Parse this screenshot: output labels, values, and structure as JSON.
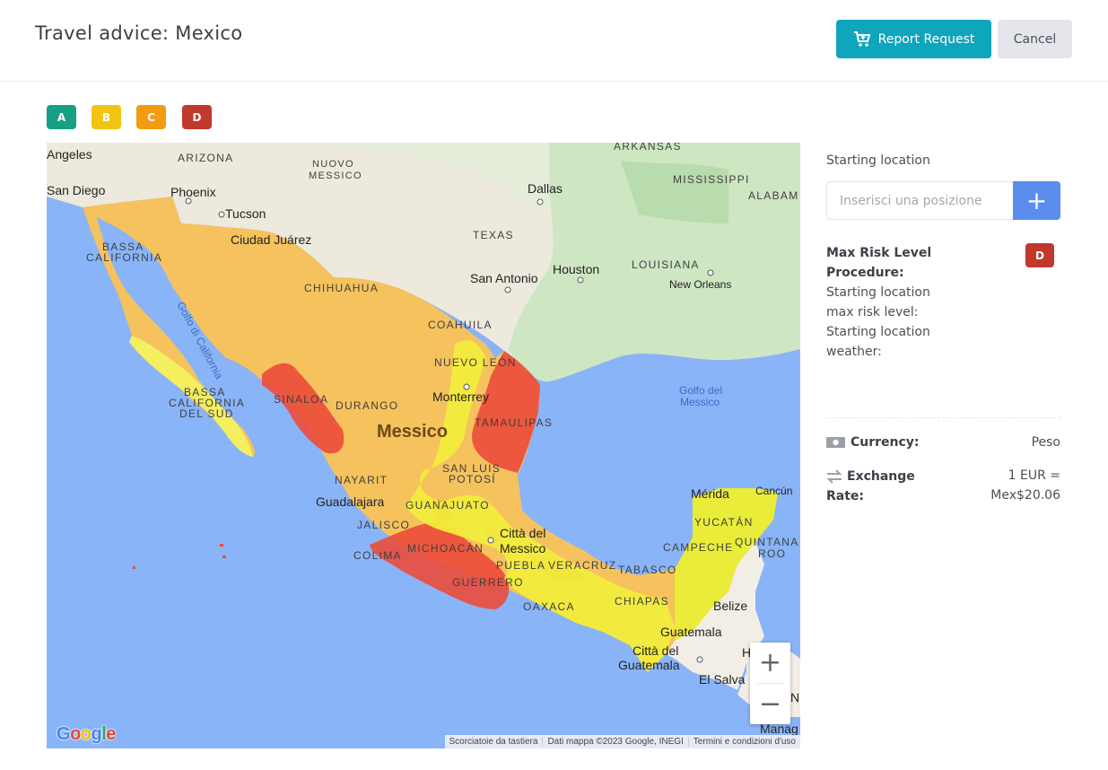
{
  "header": {
    "title": "Travel advice: Mexico",
    "report_label": "Report Request",
    "cancel_label": "Cancel"
  },
  "legend": [
    {
      "label": "A",
      "color": "#16a085"
    },
    {
      "label": "B",
      "color": "#f1c40f"
    },
    {
      "label": "C",
      "color": "#f39c12"
    },
    {
      "label": "D",
      "color": "#c0392b"
    }
  ],
  "map": {
    "labels": {
      "angeles": "Angeles",
      "arizona": "ARIZONA",
      "nuovo_messico": "NUOVO",
      "nuovo_messico2": "MESSICO",
      "arkansas": "ARKANSAS",
      "mississippi": "MISSISSIPPI",
      "alabama": "ALABAM",
      "san_diego": "San Diego",
      "phoenix": "Phoenix",
      "dallas": "Dallas",
      "tucson": "Tucson",
      "ciudad_juarez": "Ciudad Juárez",
      "texas": "TEXAS",
      "bassa_california": "BASSA",
      "bassa_california2": "CALIFORNIA",
      "houston": "Houston",
      "louisiana": "LOUISIANA",
      "san_antonio": "San Antonio",
      "new_orleans": "New Orleans",
      "chihuahua": "CHIHUAHUA",
      "golfo_california": "Golfo di California",
      "coahuila": "COAHUILA",
      "nuevo_leon": "NUEVO LEÓN",
      "bcs1": "BASSA",
      "bcs2": "CALIFORNIA",
      "bcs3": "DEL SUD",
      "sinaloa": "SINALOA",
      "monterrey": "Monterrey",
      "golfo_messico": "Golfo del",
      "golfo_messico2": "Messico",
      "durango": "DURANGO",
      "tamaulipas": "TAMAULIPAS",
      "messico": "Messico",
      "slp1": "SAN LUIS",
      "slp2": "POTOSÍ",
      "nayarit": "NAYARIT",
      "merida": "Mérida",
      "cancun": "Cancún",
      "guadalajara": "Guadalajara",
      "guanajuato": "GUANAJUATO",
      "yucatan": "YUCATÁN",
      "jalisco": "JALISCO",
      "citta_messico": "Città del",
      "citta_messico2": "Messico",
      "campeche": "CAMPECHE",
      "quintana": "QUINTANA",
      "roo": "ROO",
      "michoacan": "MICHOACÁN",
      "colima": "COLIMA",
      "puebla": "PUEBLA",
      "veracruz": "VERACRUZ",
      "tabasco": "TABASCO",
      "guerrero": "GUERRERO",
      "chiapas": "CHIAPAS",
      "oaxaca": "OAXACA",
      "belize": "Belize",
      "guatemala": "Guatemala",
      "citta_guat": "Città del",
      "citta_guat2": "Guatemala",
      "h": "H",
      "el_salvador": "El Salva",
      "ni": "Ni",
      "manag": "Manag"
    },
    "zoom_in": "+",
    "zoom_out": "−",
    "google": "Google",
    "attribution": [
      "Scorciatoie da tastiera",
      "Dati mappa ©2023 Google, INEGI",
      "Termini e condizioni d'uso"
    ]
  },
  "sidebar": {
    "starting_location_label": "Starting location",
    "location_placeholder": "Inserisci una posizione",
    "add_label": "+",
    "max_risk_label": "Max Risk Level",
    "procedure_label": "Procedure:",
    "start_max_risk": "Starting location max risk level:",
    "start_weather": "Starting location weather:",
    "max_risk_value": "D",
    "currency_label": "Currency:",
    "currency_value": "Peso",
    "exchange_label_1": "Exchange",
    "exchange_label_2": "Rate:",
    "exchange_value_1": "1 EUR =",
    "exchange_value_2": "Mex$20.06"
  }
}
